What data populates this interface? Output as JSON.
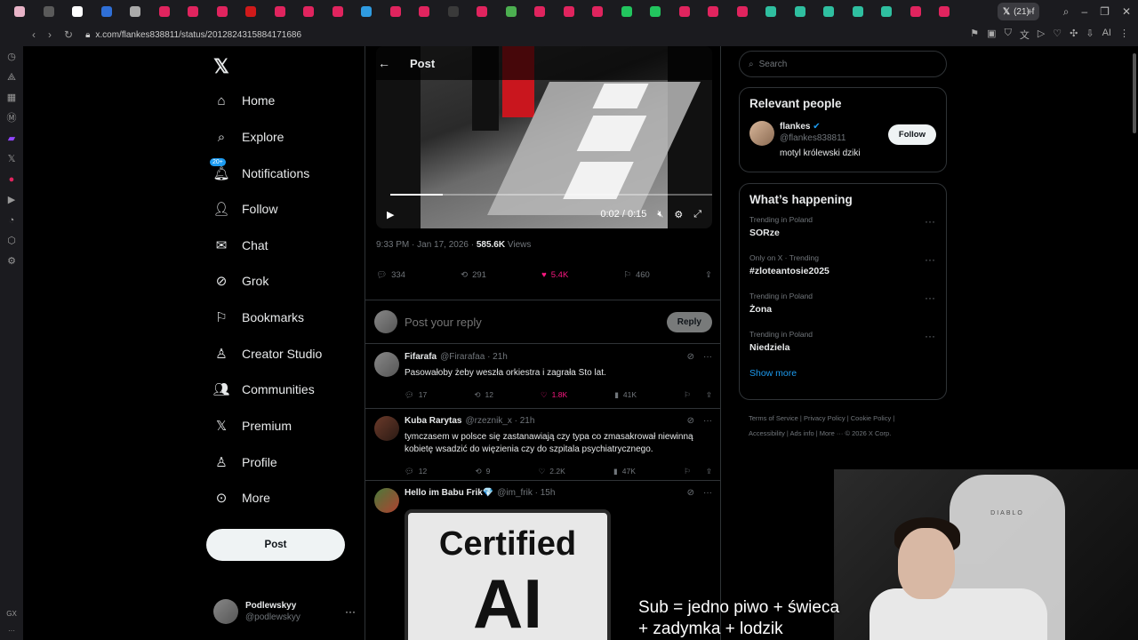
{
  "browser": {
    "active_tab_label": "(21) f",
    "url": "x.com/flankes838811/status/2012824315884171686",
    "favicon_colors": [
      "#e8b3c7",
      "#5a5a5a",
      "#ffffff",
      "#2f6fd6",
      "#aaaaaa",
      "#e0245e",
      "#e0245e",
      "#e0245e",
      "#d01a1a",
      "#e0245e",
      "#e0245e",
      "#e0245e",
      "#2f9be0",
      "#e0245e",
      "#e0245e",
      "#3a3a3a",
      "#e0245e",
      "#4caf50",
      "#e0245e",
      "#e0245e",
      "#e0245e",
      "#22c55e",
      "#22c55e",
      "#e0245e",
      "#e0245e",
      "#e0245e",
      "#2fbfa0",
      "#2fbfa0",
      "#2fbfa0",
      "#2fbfa0",
      "#2fbfa0",
      "#e0245e",
      "#e0245e"
    ]
  },
  "nav": {
    "items": [
      {
        "label": "Home",
        "icon": "home-icon"
      },
      {
        "label": "Explore",
        "icon": "search-icon"
      },
      {
        "label": "Notifications",
        "icon": "bell-icon",
        "badge": "20+"
      },
      {
        "label": "Follow",
        "icon": "follow-icon"
      },
      {
        "label": "Chat",
        "icon": "mail-icon"
      },
      {
        "label": "Grok",
        "icon": "grok-icon"
      },
      {
        "label": "Bookmarks",
        "icon": "bookmark-icon"
      },
      {
        "label": "Creator Studio",
        "icon": "creator-icon"
      },
      {
        "label": "Communities",
        "icon": "communities-icon"
      },
      {
        "label": "Premium",
        "icon": "x-icon"
      },
      {
        "label": "Profile",
        "icon": "profile-icon"
      },
      {
        "label": "More",
        "icon": "more-icon"
      }
    ],
    "post_button": "Post",
    "account": {
      "name": "Podlewskyy",
      "handle": "@podlewskyy"
    }
  },
  "post": {
    "header": "Post",
    "video_time": "0:02 / 0:15",
    "video_progress": 0.16,
    "meta_time": "9:33 PM · Jan 17, 2026 · ",
    "views_count": "585.6K",
    "views_label": " Views",
    "replies": "334",
    "reposts": "291",
    "likes": "5.4K",
    "bookmarks": "460",
    "reply_placeholder": "Post your reply",
    "reply_button": "Reply"
  },
  "replies": [
    {
      "name": "Fifarafa",
      "handle": "@Firarafaa · 21h",
      "text": "Pasowałoby żeby weszła orkiestra i zagrała Sto lat.",
      "replies": "17",
      "reposts": "12",
      "likes": "1.8K",
      "views": "41K"
    },
    {
      "name": "Kuba Rarytas",
      "handle": "@rzeznik_x · 21h",
      "text": "tymczasem w polsce się zastanawiają czy typa co zmasakrował niewinną kobietę wsadzić do więzienia czy do szpitala psychiatrycznego.",
      "replies": "12",
      "reposts": "9",
      "likes": "2.2K",
      "views": "47K"
    },
    {
      "name": "Hello im Babu Frik💎",
      "handle": "@im_frik · 15h",
      "image_text_1": "Certified",
      "image_text_2": "AI"
    }
  ],
  "sidebar": {
    "search_placeholder": "Search",
    "relevant_title": "Relevant people",
    "person": {
      "name": "flankes",
      "handle": "@flankes838811",
      "bio": "motyl królewski dziki",
      "follow_label": "Follow"
    },
    "happening_title": "What’s happening",
    "trends": [
      {
        "category": "Trending in Poland",
        "name": "SORze"
      },
      {
        "category": "Only on X · Trending",
        "name": "#zloteantosie2025"
      },
      {
        "category": "Trending in Poland",
        "name": "Żona"
      },
      {
        "category": "Trending in Poland",
        "name": "Niedziela"
      }
    ],
    "show_more": "Show more",
    "footer_line1": "Terms of Service  |  Privacy Policy  |  Cookie Policy  |",
    "footer_line2": "Accessibility  |  Ads info  |  More ···  © 2026 X Corp."
  },
  "overlay": {
    "caption_line1": "Sub = jedno piwo + świeca",
    "caption_line2": " + zadymka + lodzik",
    "chair_text": "DIABLO"
  },
  "colors": {
    "accent": "#1d9bf0",
    "like": "#f91880",
    "background": "#000000",
    "border": "#2f3336"
  }
}
